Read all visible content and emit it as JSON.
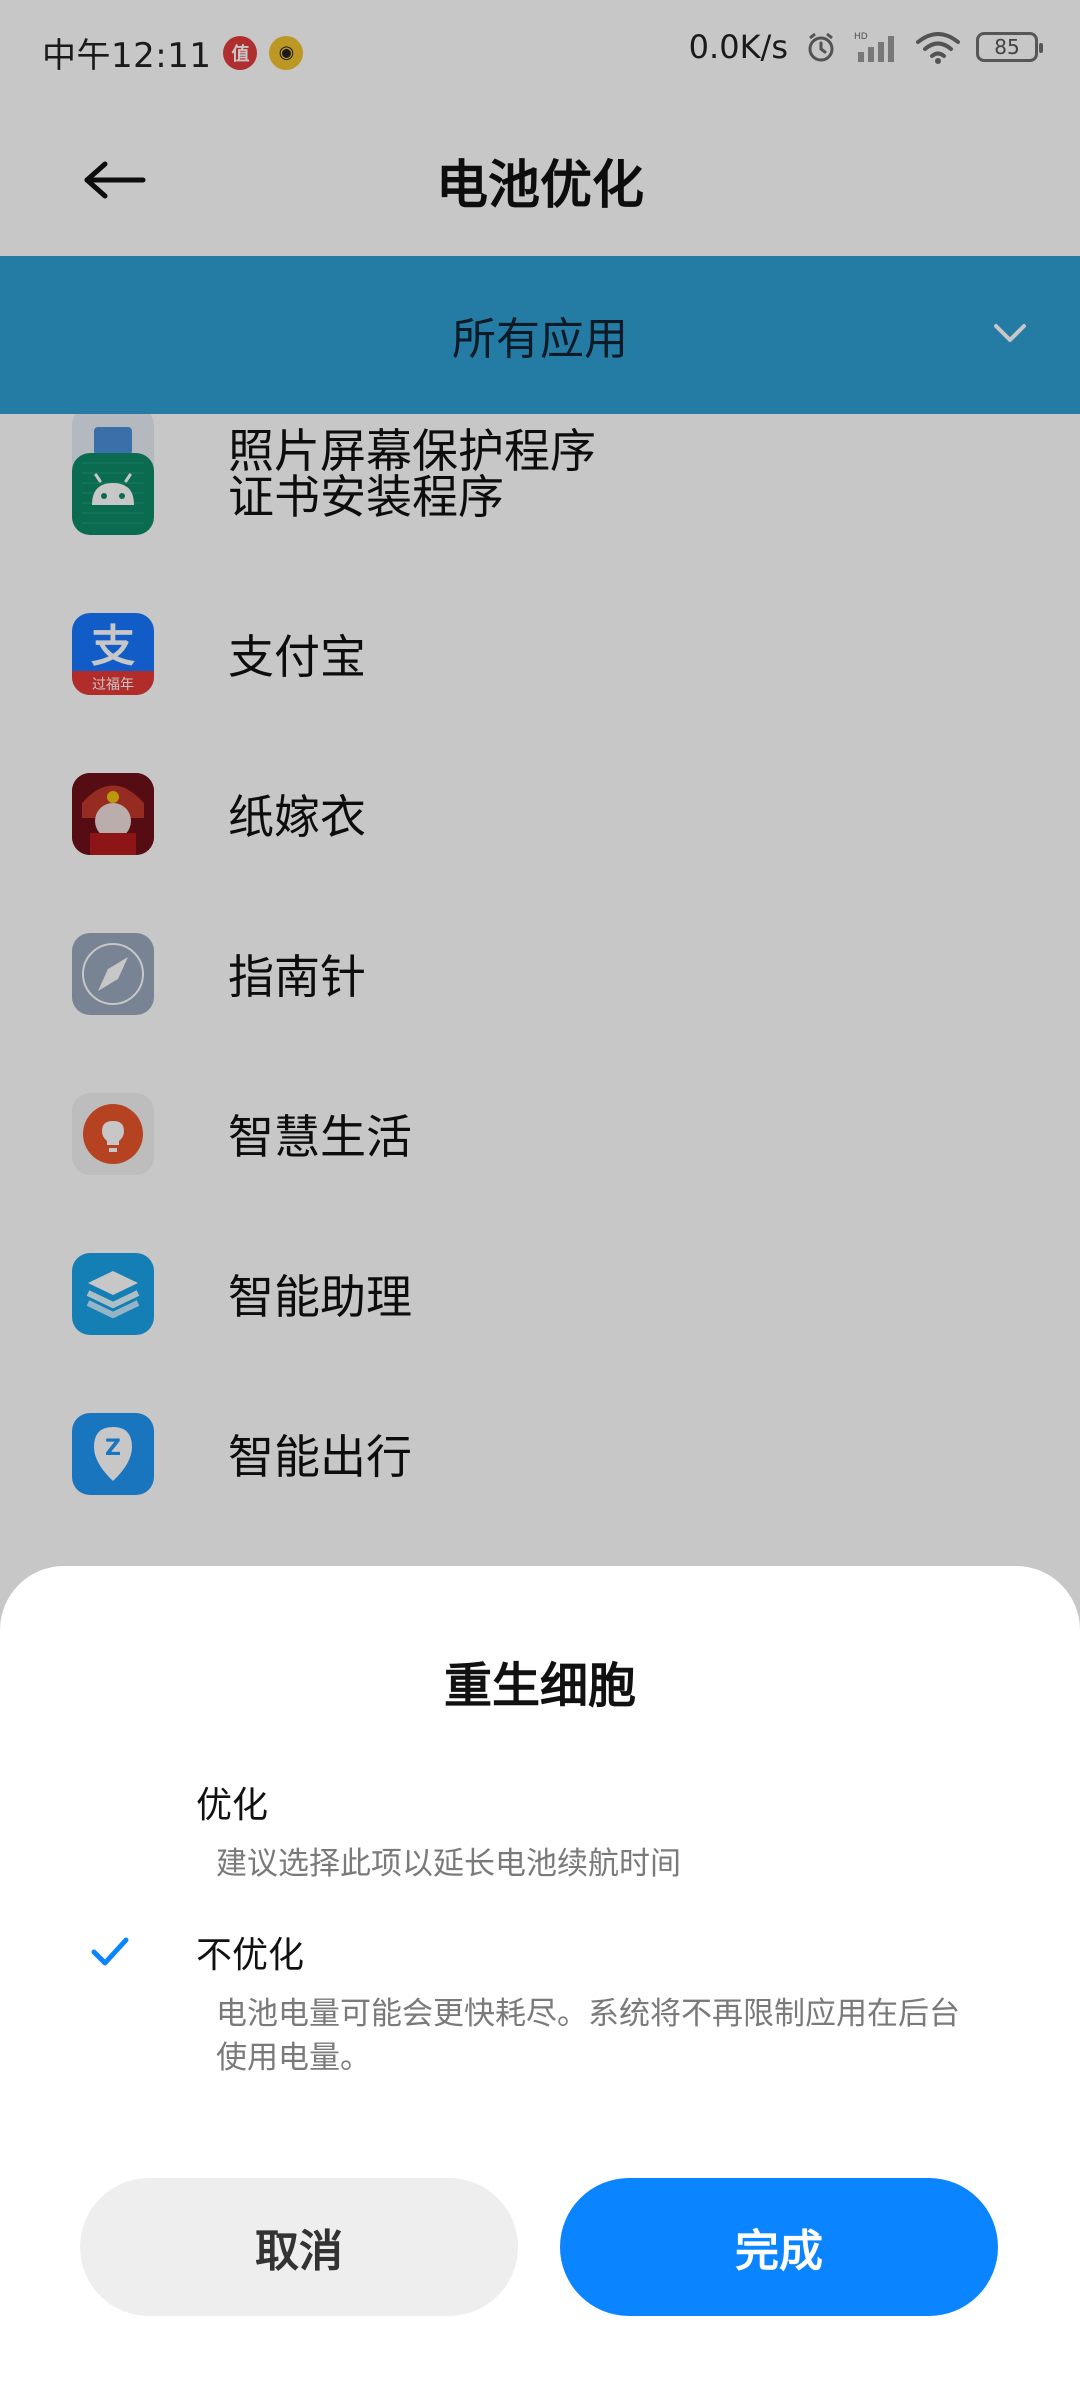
{
  "status_bar": {
    "time": "中午12:11",
    "badge_1": "值",
    "badge_2": "",
    "network_speed": "0.0K/s",
    "battery_level": "85"
  },
  "header": {
    "title": "电池优化"
  },
  "filter": {
    "label": "所有应用"
  },
  "apps": [
    {
      "name": "照片屏幕保护程序",
      "icon": "screensaver-icon"
    },
    {
      "name": "证书安装程序",
      "icon": "android-icon"
    },
    {
      "name": "支付宝",
      "icon": "alipay-icon",
      "icon_subtext": "过福年"
    },
    {
      "name": "纸嫁衣",
      "icon": "paper-bride-icon"
    },
    {
      "name": "指南针",
      "icon": "compass-icon"
    },
    {
      "name": "智慧生活",
      "icon": "smart-life-icon"
    },
    {
      "name": "智能助理",
      "icon": "assistant-icon"
    },
    {
      "name": "智能出行",
      "icon": "smart-travel-icon"
    }
  ],
  "sheet": {
    "title": "重生细胞",
    "options": [
      {
        "title": "优化",
        "description": "建议选择此项以延长电池续航时间",
        "selected": false
      },
      {
        "title": "不优化",
        "description": "电池电量可能会更快耗尽。系统将不再限制应用在后台使用电量。",
        "selected": true
      }
    ],
    "cancel_label": "取消",
    "confirm_label": "完成"
  },
  "colors": {
    "accent": "#0b84ff",
    "filter_bar": "#2f9fd3",
    "check": "#0b84ff"
  }
}
